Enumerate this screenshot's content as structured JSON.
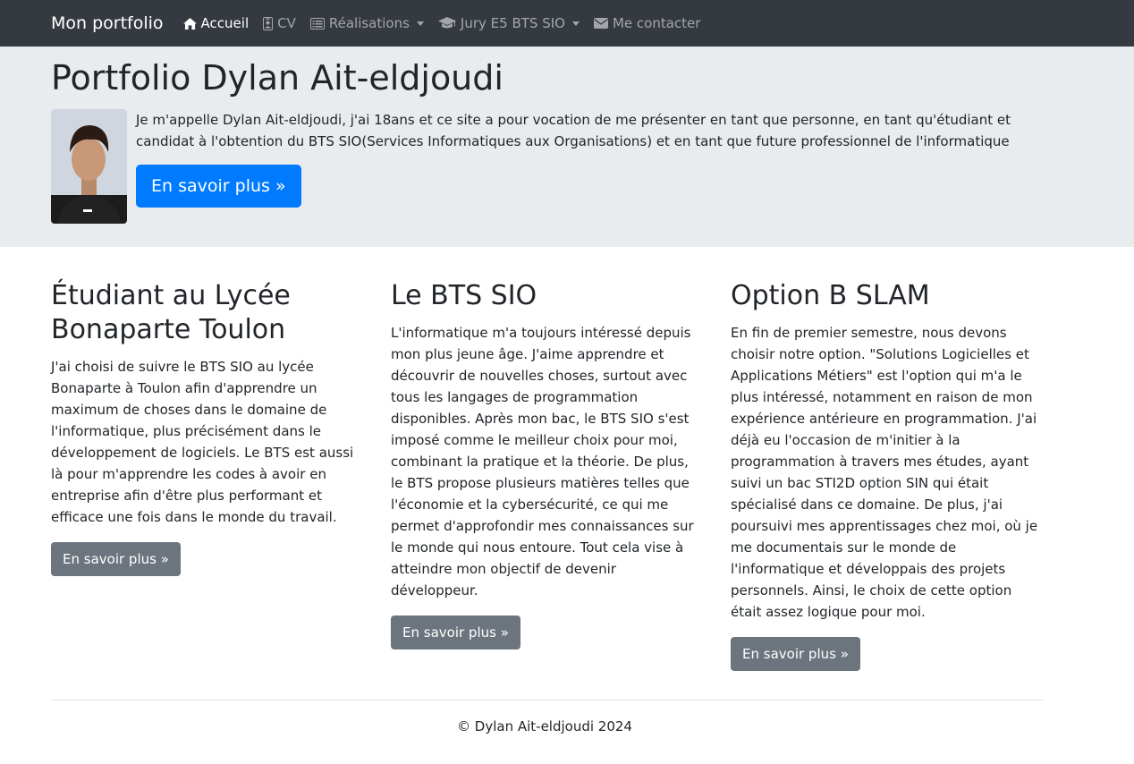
{
  "navbar": {
    "brand": "Mon portfolio",
    "items": [
      {
        "label": "Accueil",
        "icon": "home-icon",
        "active": true
      },
      {
        "label": "CV",
        "icon": "id-badge-icon"
      },
      {
        "label": "Réalisations",
        "icon": "list-alt-icon",
        "dropdown": true
      },
      {
        "label": "Jury E5 BTS SIO",
        "icon": "graduation-cap-icon",
        "dropdown": true
      },
      {
        "label": "Me contacter",
        "icon": "envelope-icon"
      }
    ]
  },
  "jumbotron": {
    "title": "Portfolio Dylan Ait-eldjoudi",
    "text": "Je m'appelle Dylan Ait-eldjoudi, j'ai 18ans et ce site a pour vocation de me présenter en tant que personne, en tant qu'étudiant et candidat à l'obtention du BTS SIO(Services Informatiques aux Organisations) et en tant que future professionnel de l'informatique",
    "button": "En savoir plus »"
  },
  "columns": [
    {
      "title": "Étudiant au Lycée Bonaparte Toulon",
      "text": "J'ai choisi de suivre le BTS SIO au lycée Bonaparte à Toulon afin d'apprendre un maximum de choses dans le domaine de l'informatique, plus précisément dans le développement de logiciels. Le BTS est aussi là pour m'apprendre les codes à avoir en entreprise afin d'être plus performant et efficace une fois dans le monde du travail.",
      "button": "En savoir plus »"
    },
    {
      "title": "Le BTS SIO",
      "text": "L'informatique m'a toujours intéressé depuis mon plus jeune âge. J'aime apprendre et découvrir de nouvelles choses, surtout avec tous les langages de programmation disponibles. Après mon bac, le BTS SIO s'est imposé comme le meilleur choix pour moi, combinant la pratique et la théorie. De plus, le BTS propose plusieurs matières telles que l'économie et la cybersécurité, ce qui me permet d'approfondir mes connaissances sur le monde qui nous entoure. Tout cela vise à atteindre mon objectif de devenir développeur.",
      "button": "En savoir plus »"
    },
    {
      "title": "Option B SLAM",
      "text": "En fin de premier semestre, nous devons choisir notre option. \"Solutions Logicielles et Applications Métiers\" est l'option qui m'a le plus intéressé, notamment en raison de mon expérience antérieure en programmation. J'ai déjà eu l'occasion de m'initier à la programmation à travers mes études, ayant suivi un bac STI2D option SIN qui était spécialisé dans ce domaine. De plus, j'ai poursuivi mes apprentissages chez moi, où je me documentais sur le monde de l'informatique et développais des projets personnels. Ainsi, le choix de cette option était assez logique pour moi.",
      "button": "En savoir plus »"
    }
  ],
  "footer": {
    "text": "© Dylan Ait-eldjoudi 2024"
  },
  "colors": {
    "navbar": "#343a40",
    "jumbotron": "#e9ecef",
    "primary": "#007bff",
    "secondary": "#6c757d"
  }
}
